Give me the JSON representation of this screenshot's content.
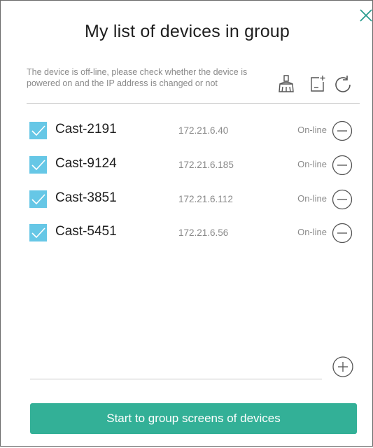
{
  "dialog": {
    "title": "My list of devices in group",
    "notice": "The device is off-line, please check whether the device is powered on and the IP address is changed or not",
    "close_icon": "close-icon"
  },
  "toolbar": {
    "icons": [
      "broom-icon",
      "add-document-icon",
      "refresh-icon"
    ]
  },
  "devices": [
    {
      "name": "Cast-2191",
      "ip": "172.21.6.40",
      "status": "On-line",
      "checked": true
    },
    {
      "name": "Cast-9124",
      "ip": "172.21.6.185",
      "status": "On-line",
      "checked": true
    },
    {
      "name": "Cast-3851",
      "ip": "172.21.6.112",
      "status": "On-line",
      "checked": true
    },
    {
      "name": "Cast-5451",
      "ip": "172.21.6.56",
      "status": "On-line",
      "checked": true
    }
  ],
  "footer": {
    "add_icon": "add-circle-icon",
    "start_button_label": "Start to group screens of devices"
  },
  "colors": {
    "checkbox": "#66c7e6",
    "primary_button": "#33b097",
    "close_icon": "#2a9d8f",
    "icon_gray": "#555555",
    "secondary_text": "#8a8a8a"
  }
}
